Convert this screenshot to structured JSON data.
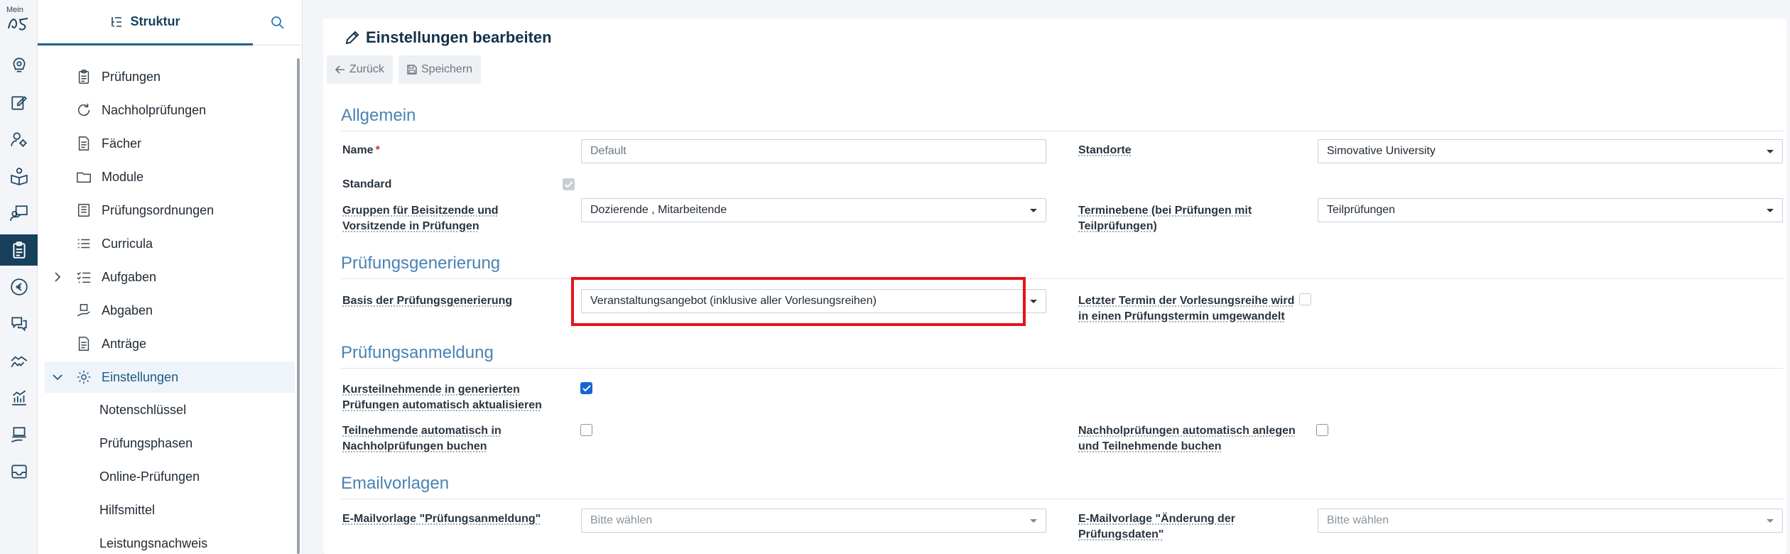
{
  "rail": {
    "logo_text": "Mein",
    "logo_mark": "c5",
    "icons": [
      "dashboard-icon",
      "edit-icon",
      "user-settings-icon",
      "book-reader-icon",
      "teacher-icon",
      "exam-clipboard-icon",
      "euro-icon",
      "chat-icon",
      "handshake-icon",
      "analytics-icon",
      "laptop-hand-icon",
      "inbox-icon"
    ]
  },
  "sidebar": {
    "tab_label": "Struktur",
    "items": [
      {
        "label": "Prüfungen"
      },
      {
        "label": "Nachholprüfungen"
      },
      {
        "label": "Fächer"
      },
      {
        "label": "Module"
      },
      {
        "label": "Prüfungsordnungen"
      },
      {
        "label": "Curricula"
      },
      {
        "label": "Aufgaben"
      },
      {
        "label": "Abgaben"
      },
      {
        "label": "Anträge"
      },
      {
        "label": "Einstellungen"
      }
    ],
    "subitems": [
      {
        "label": "Notenschlüssel"
      },
      {
        "label": "Prüfungsphasen"
      },
      {
        "label": "Online-Prüfungen"
      },
      {
        "label": "Hilfsmittel"
      },
      {
        "label": "Leistungsnachweis"
      }
    ]
  },
  "main": {
    "title": "Einstellungen bearbeiten",
    "back_label": "Zurück",
    "save_label": "Speichern",
    "sections": {
      "allgemein": "Allgemein",
      "generierung": "Prüfungsgenerierung",
      "anmeldung": "Prüfungsanmeldung",
      "email": "Emailvorlagen"
    },
    "fields": {
      "name_label": "Name",
      "name_required": "*",
      "name_value": "Default",
      "standorte_label": "Standorte",
      "standorte_value": "Simovative University",
      "standard_label": "Standard",
      "standard_checked": true,
      "gruppen_label_1": "Gruppen für Beisitzende und",
      "gruppen_label_2": "Vorsitzende in Prüfungen",
      "gruppen_value": "Dozierende , Mitarbeitende",
      "terminebene_label_1": "Terminebene (bei Prüfungen mit",
      "terminebene_label_2": "Teilprüfungen)",
      "terminebene_value": "Teilprüfungen",
      "basis_label": "Basis der Prüfungsgenerierung",
      "basis_value": "Veranstaltungsangebot (inklusive aller Vorlesungsreihen)",
      "letzter_label_1": "Letzter Termin der Vorlesungsreihe wird",
      "letzter_label_2": "in einen Prüfungstermin umgewandelt",
      "letzter_checked": false,
      "kurs_label_1": "Kursteilnehmende in generierten",
      "kurs_label_2": "Prüfungen automatisch aktualisieren",
      "kurs_checked": true,
      "teiln_label_1": "Teilnehmende automatisch in",
      "teiln_label_2": "Nachholprüfungen buchen",
      "teiln_checked": false,
      "nachhol_label_1": "Nachholprüfungen automatisch anlegen",
      "nachhol_label_2": "und Teilnehmende buchen",
      "nachhol_checked": false,
      "email_anmeldung_label": "E-Mailvorlage \"Prüfungsanmeldung\"",
      "email_anmeldung_value": "Bitte wählen",
      "email_aenderung_label_1": "E-Mailvorlage \"Änderung der",
      "email_aenderung_label_2": "Prüfungsdaten\"",
      "email_aenderung_value": "Bitte wählen"
    }
  },
  "colors": {
    "accent": "#1f5f8b",
    "section": "#4a82b3",
    "highlight": "#e0161b",
    "checkbox": "#1565d8"
  }
}
